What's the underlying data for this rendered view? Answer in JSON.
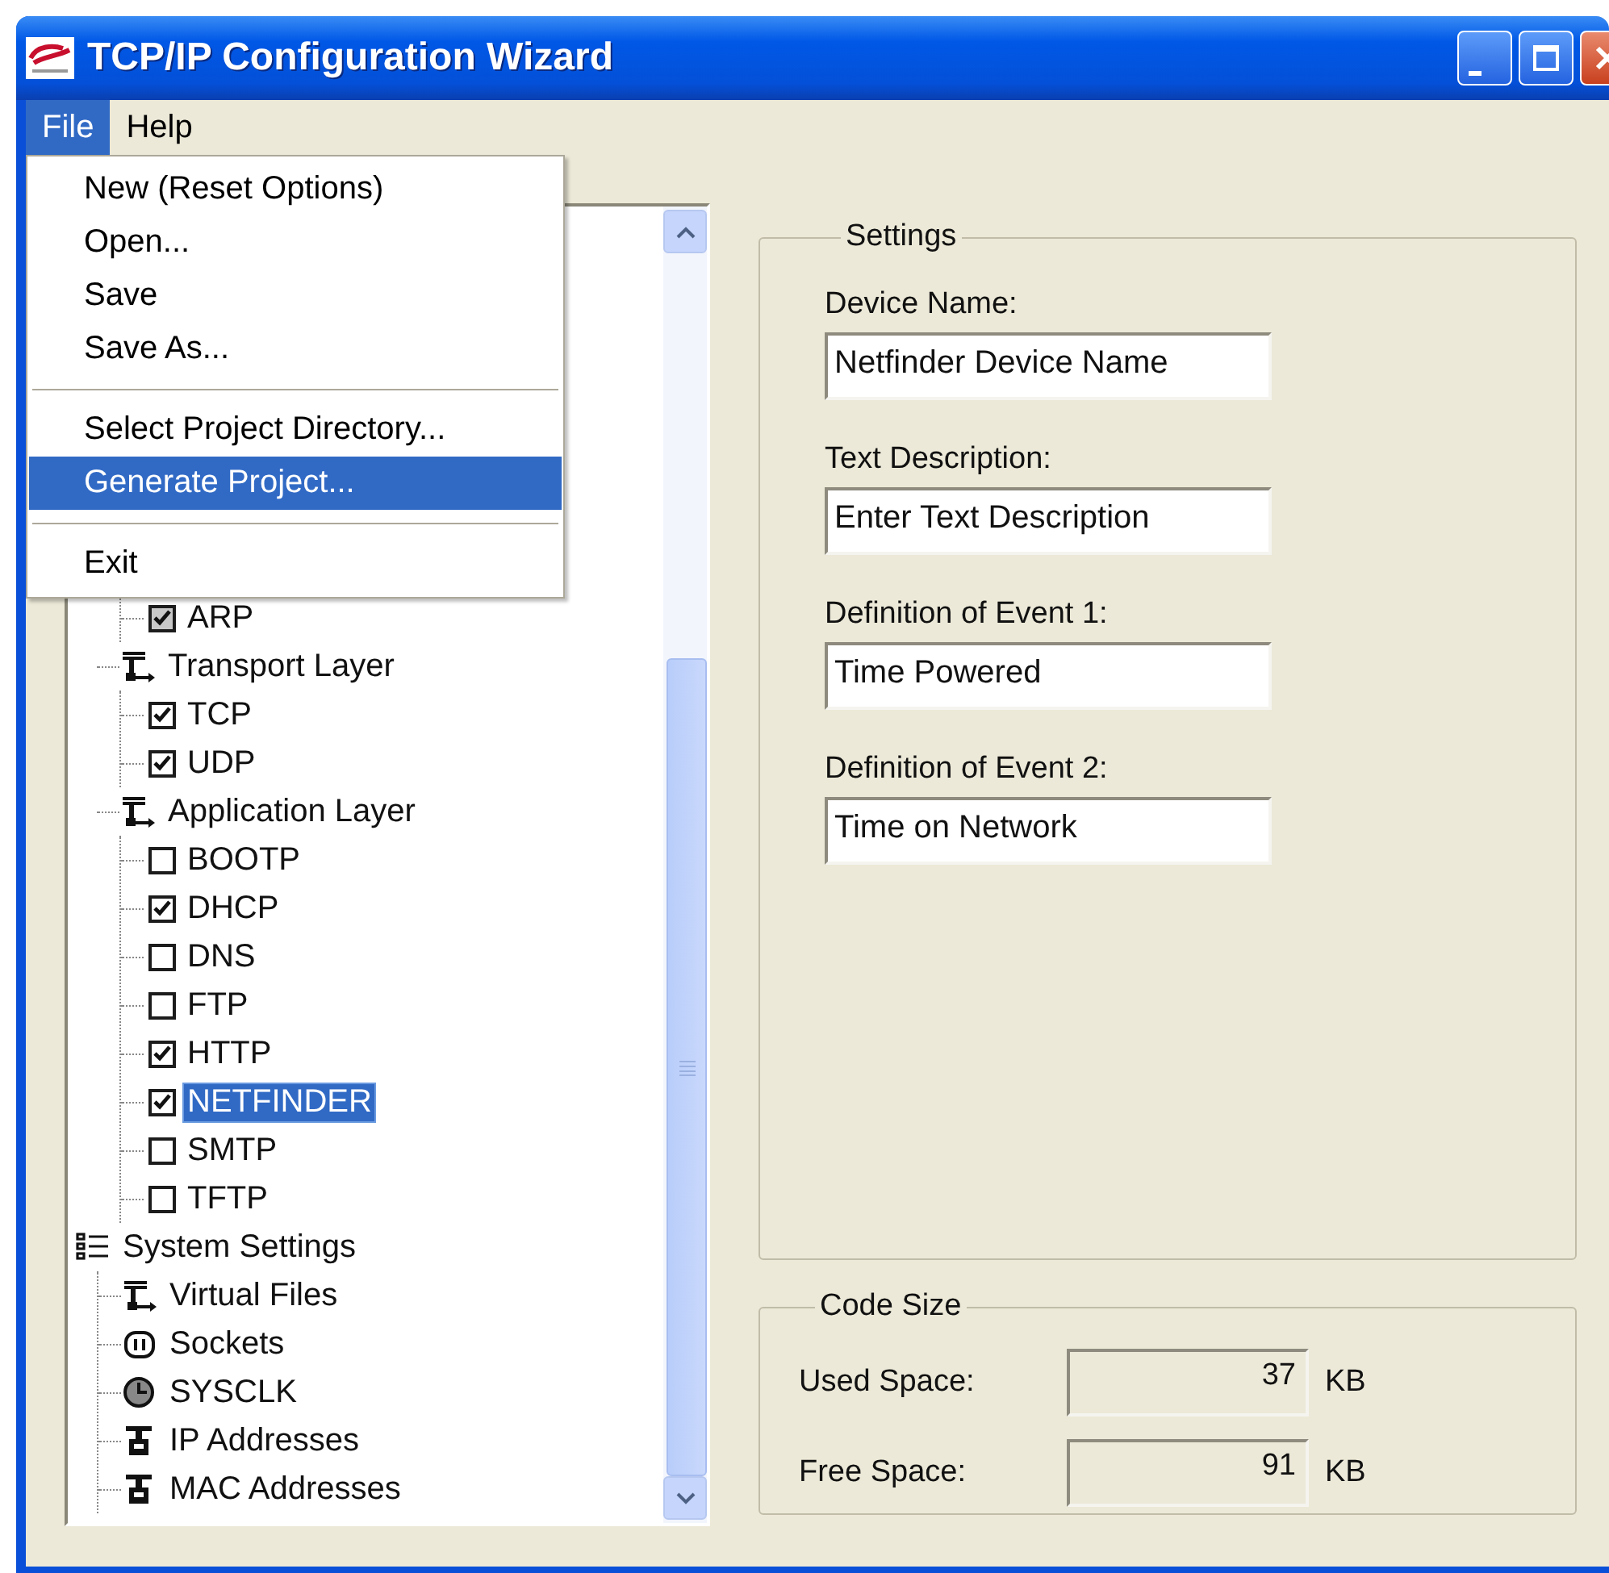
{
  "window": {
    "title": "TCP/IP Configuration Wizard"
  },
  "menubar": [
    {
      "label": "File",
      "selected": true
    },
    {
      "label": "Help",
      "selected": false
    }
  ],
  "file_menu": [
    {
      "kind": "item",
      "label": "New (Reset Options)",
      "selected": false
    },
    {
      "kind": "item",
      "label": "Open...",
      "selected": false
    },
    {
      "kind": "item",
      "label": "Save",
      "selected": false
    },
    {
      "kind": "item",
      "label": "Save As...",
      "selected": false
    },
    {
      "kind": "separator"
    },
    {
      "kind": "item",
      "label": "Select Project Directory...",
      "selected": false
    },
    {
      "kind": "item",
      "label": "Generate Project...",
      "selected": true
    },
    {
      "kind": "separator"
    },
    {
      "kind": "item",
      "label": "Exit",
      "selected": false
    }
  ],
  "tree": [
    {
      "kind": "group",
      "children": [
        {
          "kind": "group",
          "children": [
            {
              "kind": "check",
              "label": "ARP",
              "checked": true,
              "disabled": true,
              "selected": false
            }
          ]
        },
        {
          "kind": "layer",
          "label": "Transport Layer",
          "selected": false,
          "children": [
            {
              "kind": "check",
              "label": "TCP",
              "checked": true,
              "disabled": false,
              "selected": false
            },
            {
              "kind": "check",
              "label": "UDP",
              "checked": true,
              "disabled": false,
              "selected": false
            }
          ]
        },
        {
          "kind": "layer",
          "label": "Application Layer",
          "selected": false,
          "children": [
            {
              "kind": "check",
              "label": "BOOTP",
              "checked": false,
              "disabled": false,
              "selected": false
            },
            {
              "kind": "check",
              "label": "DHCP",
              "checked": true,
              "disabled": false,
              "selected": false
            },
            {
              "kind": "check",
              "label": "DNS",
              "checked": false,
              "disabled": false,
              "selected": false
            },
            {
              "kind": "check",
              "label": "FTP",
              "checked": false,
              "disabled": false,
              "selected": false
            },
            {
              "kind": "check",
              "label": "HTTP",
              "checked": true,
              "disabled": false,
              "selected": false
            },
            {
              "kind": "check",
              "label": "NETFINDER",
              "checked": true,
              "disabled": false,
              "selected": true
            },
            {
              "kind": "check",
              "label": "SMTP",
              "checked": false,
              "disabled": false,
              "selected": false
            },
            {
              "kind": "check",
              "label": "TFTP",
              "checked": false,
              "disabled": false,
              "selected": false
            }
          ]
        }
      ]
    },
    {
      "kind": "list",
      "label": "System Settings",
      "selected": false,
      "children": [
        {
          "kind": "layer",
          "label": "Virtual Files",
          "selected": false
        },
        {
          "kind": "socket",
          "label": "Sockets",
          "selected": false
        },
        {
          "kind": "clock",
          "label": "SYSCLK",
          "selected": false
        },
        {
          "kind": "address",
          "label": "IP Addresses",
          "selected": false
        },
        {
          "kind": "address",
          "label": "MAC Addresses",
          "selected": false
        }
      ]
    }
  ],
  "settings": {
    "title": "Settings",
    "fields": [
      {
        "label": "Device Name:",
        "value": "Netfinder Device Name"
      },
      {
        "label": "Text Description:",
        "value": "Enter Text Description"
      },
      {
        "label": "Definition of Event 1:",
        "value": "Time Powered"
      },
      {
        "label": "Definition of Event 2:",
        "value": "Time on Network"
      }
    ]
  },
  "code_size": {
    "title": "Code Size",
    "rows": [
      {
        "label": "Used Space:",
        "value": "37",
        "unit": "KB"
      },
      {
        "label": "Free Space:",
        "value": "91",
        "unit": "KB"
      }
    ]
  }
}
